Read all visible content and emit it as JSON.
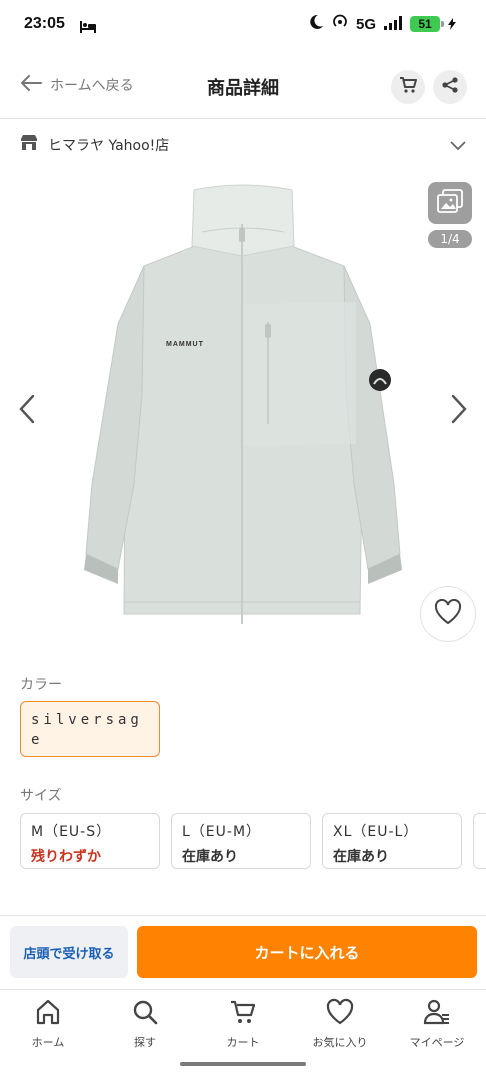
{
  "status_bar": {
    "time": "23:05",
    "network": "5G",
    "battery": "51"
  },
  "header": {
    "back_label": "ホームへ戻る",
    "title": "商品詳細"
  },
  "store": {
    "name": "ヒマラヤ Yahoo!店"
  },
  "gallery": {
    "counter": "1/4",
    "brand_text": "MAMMUT"
  },
  "color_section": {
    "label": "カラー",
    "selected": "silversage"
  },
  "size_section": {
    "label": "サイズ",
    "options": [
      {
        "size": "M（EU-S）",
        "stock": "残りわずか"
      },
      {
        "size": "L（EU-M）",
        "stock": "在庫あり"
      },
      {
        "size": "XL（EU-L）",
        "stock": "在庫あり"
      }
    ]
  },
  "actions": {
    "pickup_label": "店頭で受け取る",
    "cart_label": "カートに入れる"
  },
  "tabs": [
    {
      "label": "ホーム",
      "icon": "home-icon"
    },
    {
      "label": "探す",
      "icon": "search-icon"
    },
    {
      "label": "カート",
      "icon": "cart-icon"
    },
    {
      "label": "お気に入り",
      "icon": "heart-icon"
    },
    {
      "label": "マイページ",
      "icon": "user-icon"
    }
  ],
  "colors": {
    "accent": "#ff8200",
    "low_stock": "#c8331e",
    "pickup_text": "#1a5fb4",
    "chip_border": "#f08a2e"
  }
}
